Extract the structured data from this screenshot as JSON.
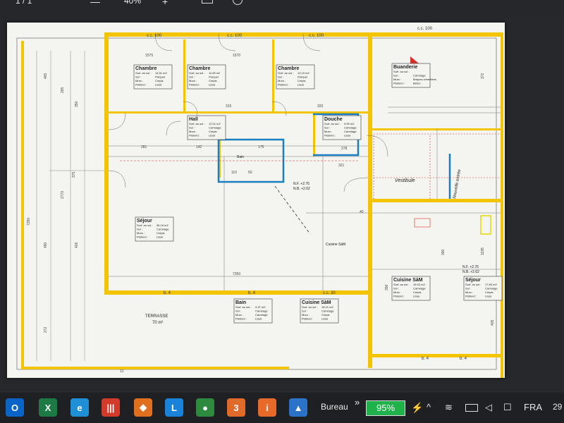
{
  "toolbar": {
    "page_indicator": "1 / 1",
    "zoom_out": "—",
    "zoom_level": "40%",
    "zoom_in": "+"
  },
  "plan": {
    "rooms": [
      {
        "name": "Chambre",
        "surf": "14.51 m2",
        "sol": "Parquet",
        "murs": "Crépis",
        "plafond": "Lissé"
      },
      {
        "name": "Chambre",
        "surf": "11.65 m2",
        "sol": "Parquet",
        "murs": "Crépis",
        "plafond": "Lissé"
      },
      {
        "name": "Chambre",
        "surf": "13.15 m2",
        "sol": "Parquet",
        "murs": "Crépis",
        "plafond": "Lissé"
      },
      {
        "name": "Buanderie",
        "surf": "",
        "sol": "Carrelage",
        "murs": "Briques cimentées",
        "plafond": "Béton"
      },
      {
        "name": "Hall",
        "surf": "12.01 m2",
        "sol": "Carrelage",
        "murs": "Crépis",
        "plafond": "Lissé"
      },
      {
        "name": "Douche",
        "surf": "3.99 m2",
        "sol": "Carrelage",
        "murs": "Carrelage",
        "plafond": "Lissé"
      },
      {
        "name": "Séjour",
        "surf": "36.15 m2",
        "sol": "Carrelage",
        "murs": "Crépis",
        "plafond": "Lissé"
      },
      {
        "name": "Bain",
        "surf": "4.37 m2",
        "sol": "Carrelage",
        "murs": "Carrelage",
        "plafond": "Lissé"
      },
      {
        "name": "Cuisine SàM",
        "surf": "18.21 m2",
        "sol": "Carrelage",
        "murs": "Crépis",
        "plafond": "Lissé"
      },
      {
        "name": "Cuisine SàM",
        "surf": "15.92 m2",
        "sol": "Carrelage",
        "murs": "Crépis",
        "plafond": "Lissé"
      },
      {
        "name": "Séjour",
        "surf": "17.80 m2",
        "sol": "Carrelage",
        "murs": "Crépis",
        "plafond": "Lissé"
      }
    ],
    "field_labels": {
      "surf": "Surf. au sol :",
      "sol": "Sol :",
      "murs": "Murs :",
      "plafond": "Plafond :"
    },
    "terrasse": "TERRASSE",
    "terrasse_area": "70 m²",
    "bain_sketch": "Bain",
    "cuisine_label": "Cuisine SàM",
    "vestibule": "Vestibule",
    "nouvelle_entree": "Nouvelle entrée",
    "level_1a": "N.F. +2.76",
    "level_1b": "N.B. +2.62",
    "level_2a": "N.F. +2.76",
    "level_2b": "N.B. +2.62",
    "cc_100": "c.c. 100",
    "cc_30": "c.c. 30",
    "door_b4": "b. 4",
    "dims": [
      "1570",
      "1575",
      "7290",
      "465",
      "426",
      "7350",
      "2770",
      "175",
      "281",
      "315",
      "333",
      "142",
      "110",
      "50",
      "321",
      "278",
      "372",
      "1195",
      "390",
      "40",
      "405",
      "356",
      "265",
      "350",
      "490",
      "375",
      "272",
      "12"
    ]
  },
  "taskbar": {
    "apps": [
      {
        "name": "Outlook",
        "glyph": "O",
        "color": "#0a64c8"
      },
      {
        "name": "Excel",
        "glyph": "X",
        "color": "#1d7a44"
      },
      {
        "name": "Edge",
        "glyph": "e",
        "color": "#1f8fd6"
      },
      {
        "name": "Library",
        "glyph": "|||",
        "color": "#d23a2a"
      },
      {
        "name": "Shield",
        "glyph": "◆",
        "color": "#e07020"
      },
      {
        "name": "L",
        "glyph": "L",
        "color": "#1a82d9"
      },
      {
        "name": "Chrome",
        "glyph": "●",
        "color": "#2d8a3e"
      },
      {
        "name": "App3",
        "glyph": "3",
        "color": "#e06a2a"
      },
      {
        "name": "App4",
        "glyph": "i",
        "color": "#e86a2a"
      },
      {
        "name": "Photos",
        "glyph": "▲",
        "color": "#2a73c8"
      }
    ],
    "desktop_label": "Bureau",
    "chevrons": "»",
    "battery_percent": "95%",
    "language": "FRA",
    "clock": "29",
    "colors": {
      "battery_green": "#1fb14a",
      "wall_yellow": "#f2c500",
      "annotation_blue": "#1a7fc0",
      "annotation_red": "#d9302a"
    }
  }
}
